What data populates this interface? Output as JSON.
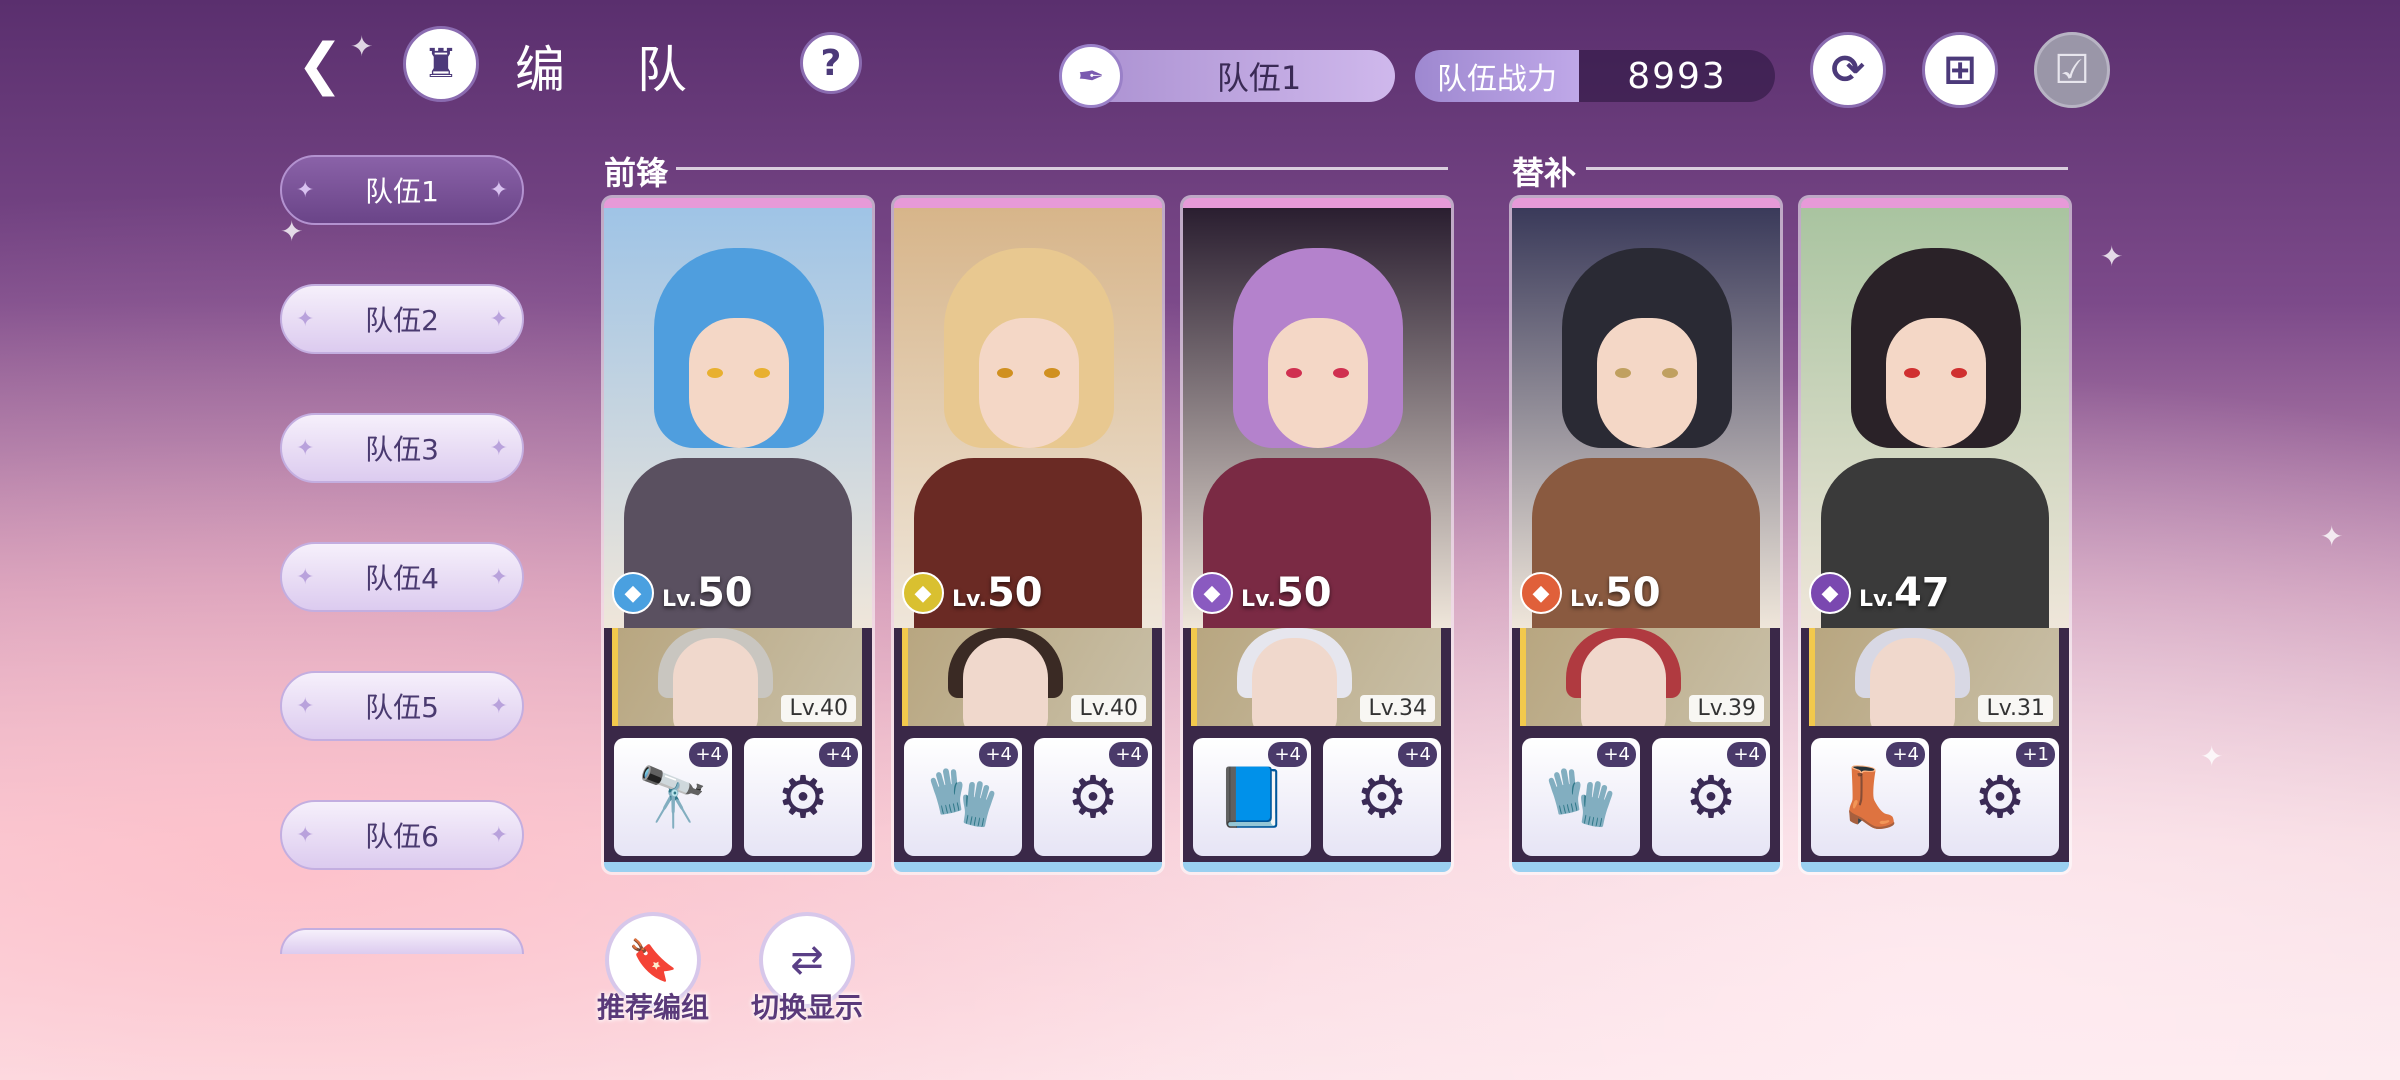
{
  "header": {
    "title": "编 队",
    "back_icon": "back-arrow-icon",
    "home_icon": "castle-icon",
    "help_label": "?",
    "current_team": "队伍1",
    "power_label": "队伍战力",
    "power_value": "8993"
  },
  "sidebar": {
    "tabs": [
      {
        "label": "队伍1",
        "active": true
      },
      {
        "label": "队伍2",
        "active": false
      },
      {
        "label": "队伍3",
        "active": false
      },
      {
        "label": "队伍4",
        "active": false
      },
      {
        "label": "队伍5",
        "active": false
      },
      {
        "label": "队伍6",
        "active": false
      }
    ]
  },
  "sections": {
    "front": "前锋",
    "sub": "替补"
  },
  "cards": [
    {
      "role_icon": "magic-wand-icon",
      "role_color": "#4aa0e0",
      "lv_prefix": "Lv.",
      "level": "50",
      "support_level": "Lv.40",
      "equip1_plus": "+4",
      "equip2_plus": "+4",
      "hair": "#4f9ede",
      "body": "#5a5060",
      "bg": "#9fc4e6",
      "eye": "#e8b030",
      "s_hair": "#c9c6c0",
      "equip1_icon": "🔭",
      "equip2_icon": "⚙"
    },
    {
      "role_icon": "fist-icon",
      "role_color": "#d9c030",
      "lv_prefix": "Lv.",
      "level": "50",
      "support_level": "Lv.40",
      "equip1_plus": "+4",
      "equip2_plus": "+4",
      "hair": "#e8c890",
      "body": "#6a2a24",
      "bg": "#d7b58a",
      "eye": "#d09020",
      "s_hair": "#3a2a24",
      "equip1_icon": "🧤",
      "equip2_icon": "⚙"
    },
    {
      "role_icon": "book-icon",
      "role_color": "#8a5ac0",
      "lv_prefix": "Lv.",
      "level": "50",
      "support_level": "Lv.34",
      "equip1_plus": "+4",
      "equip2_plus": "+4",
      "hair": "#b482cc",
      "body": "#7a2a44",
      "bg": "#2a1e30",
      "eye": "#d03050",
      "s_hair": "#e6e6ee",
      "equip1_icon": "📘",
      "equip2_icon": "⚙"
    },
    {
      "role_icon": "fist-icon",
      "role_color": "#e0603a",
      "lv_prefix": "Lv.",
      "level": "50",
      "support_level": "Lv.39",
      "equip1_plus": "+4",
      "equip2_plus": "+4",
      "hair": "#2a2a34",
      "body": "#8a5a40",
      "bg": "#3a3a5a",
      "eye": "#c0a060",
      "s_hair": "#b03a40",
      "equip1_icon": "🧤",
      "equip2_icon": "⚙"
    },
    {
      "role_icon": "boot-icon",
      "role_color": "#7a48b0",
      "lv_prefix": "Lv.",
      "level": "47",
      "support_level": "Lv.31",
      "equip1_plus": "+4",
      "equip2_plus": "+1",
      "hair": "#2a2228",
      "body": "#3a3a3a",
      "bg": "#a9c4a0",
      "eye": "#d03030",
      "s_hair": "#d8d8e4",
      "equip1_icon": "👢",
      "equip2_icon": "⚙"
    }
  ],
  "bottom": {
    "recommend_label": "推荐编组",
    "switch_label": "切换显示"
  }
}
